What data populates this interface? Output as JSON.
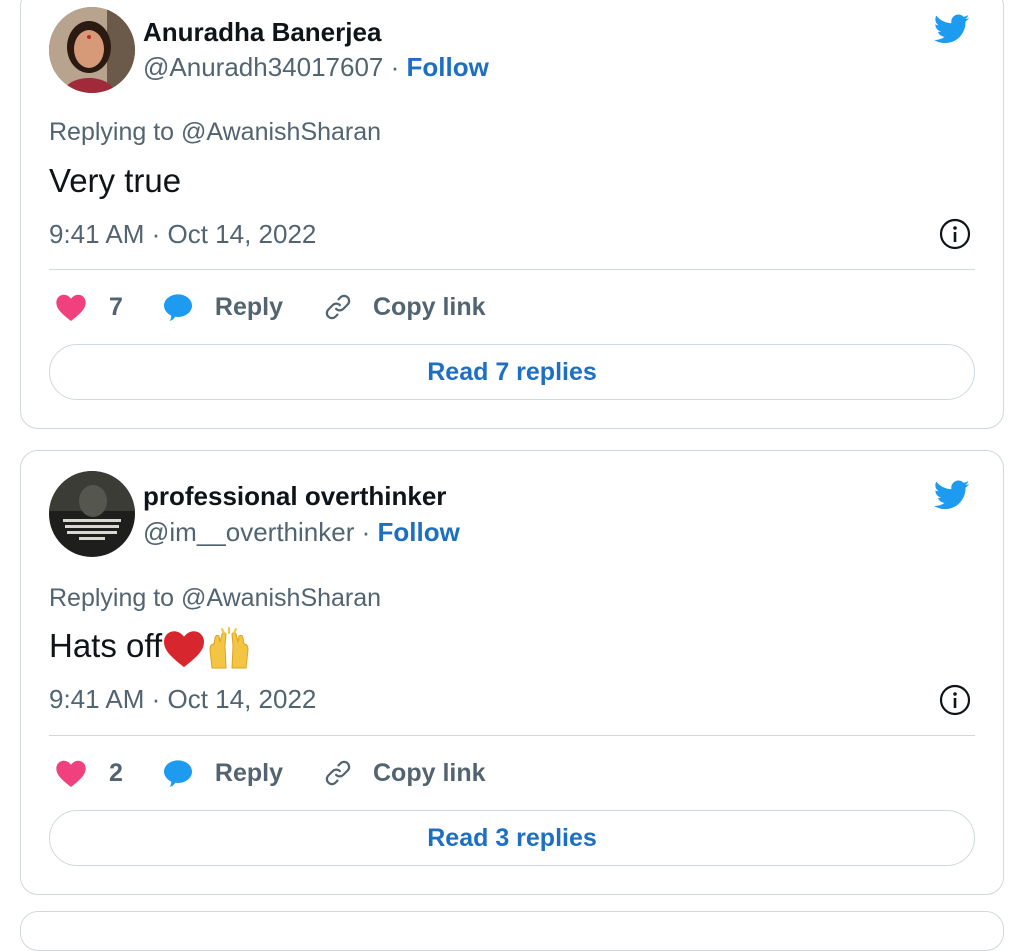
{
  "colors": {
    "link": "#1d6fc4",
    "secondary_text": "#536471",
    "border": "#cfd9de",
    "heart": "#f0407e",
    "reply_bubble": "#1d9bf0",
    "twitter_blue": "#1d9bf0"
  },
  "tweets": [
    {
      "author_name": "Anuradha Banerjea",
      "handle": "@Anuradh34017607",
      "separator": "·",
      "follow_label": "Follow",
      "replying_prefix": "Replying to",
      "replying_to": "@AwanishSharan",
      "text": "Very true",
      "timestamp": "9:41 AM · Oct 14, 2022",
      "likes": "7",
      "reply_label": "Reply",
      "copy_link_label": "Copy link",
      "read_replies_label": "Read 7 replies",
      "icons": [
        "avatar",
        "twitter-bird-icon",
        "info-icon",
        "heart-icon",
        "reply-bubble-icon",
        "link-icon"
      ]
    },
    {
      "author_name": "professional overthinker",
      "handle": "@im__overthinker",
      "separator": "·",
      "follow_label": "Follow",
      "replying_prefix": "Replying to",
      "replying_to": "@AwanishSharan",
      "text": "Hats off",
      "emojis": [
        "red-heart-emoji",
        "raising-hands-emoji"
      ],
      "timestamp": "9:41 AM · Oct 14, 2022",
      "likes": "2",
      "reply_label": "Reply",
      "copy_link_label": "Copy link",
      "read_replies_label": "Read 3 replies",
      "icons": [
        "avatar",
        "twitter-bird-icon",
        "info-icon",
        "heart-icon",
        "reply-bubble-icon",
        "link-icon"
      ]
    }
  ]
}
